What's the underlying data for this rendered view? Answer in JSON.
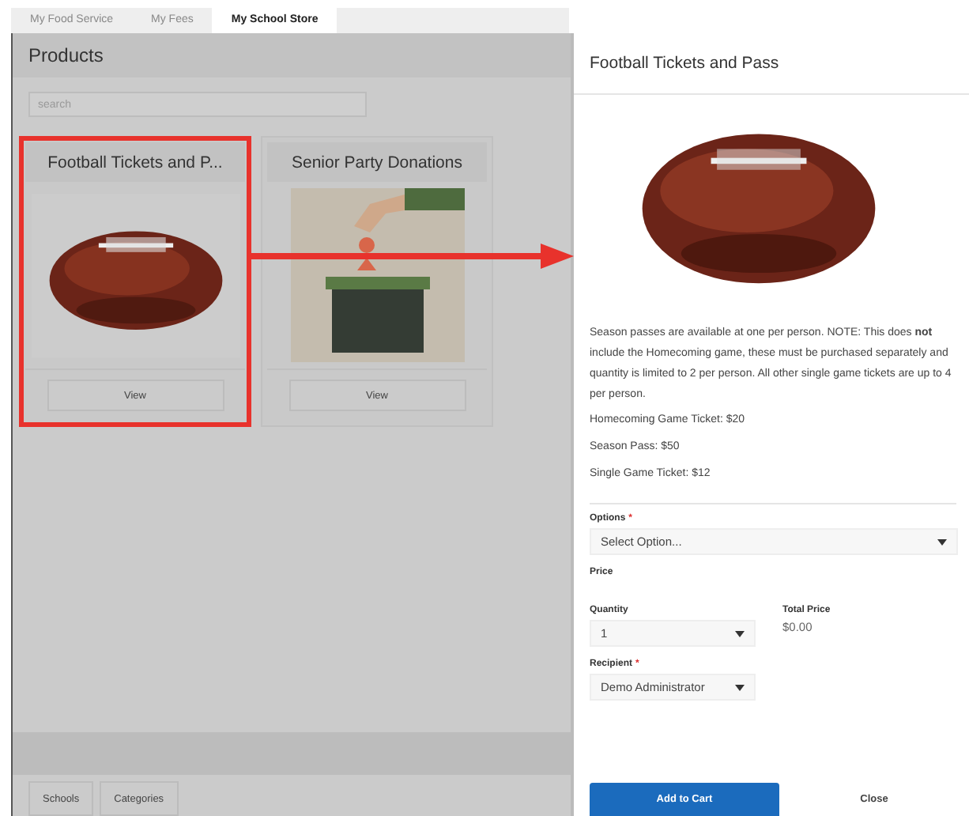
{
  "tabs": [
    {
      "label": "My Food Service",
      "selected": false
    },
    {
      "label": "My Fees",
      "selected": false
    },
    {
      "label": "My School Store",
      "selected": true
    }
  ],
  "products": {
    "title": "Products",
    "search": {
      "placeholder": "search"
    },
    "cards": [
      {
        "title": "Football Tickets and P...",
        "button": "View",
        "highlighted": true
      },
      {
        "title": "Senior Party Donations",
        "button": "View",
        "highlighted": false
      }
    ],
    "footer_buttons": [
      "Schools",
      "Categories"
    ]
  },
  "detail": {
    "title": "Football Tickets and Pass",
    "description": "Season passes are available at one per person. NOTE: This does **not** include the Homecoming game, these must be purchased separately and quantity is limited to 2 per person. All other single game tickets are up to 4 per person.",
    "prices": [
      "Homecoming Game Ticket: $20",
      "Season Pass: $50",
      "Single Game Ticket: $12"
    ],
    "options": {
      "label": "Options",
      "required_mark": "*",
      "value": "Select Option..."
    },
    "price_label": "Price",
    "quantity": {
      "label": "Quantity",
      "value": "1"
    },
    "total": {
      "label": "Total Price",
      "value": "$0.00"
    },
    "recipient": {
      "label": "Recipient",
      "required_mark": "*",
      "value": "Demo Administrator"
    },
    "buttons": [
      {
        "label": "Add to Cart",
        "kind": "primary"
      },
      {
        "label": "Close",
        "kind": "plain"
      }
    ]
  }
}
